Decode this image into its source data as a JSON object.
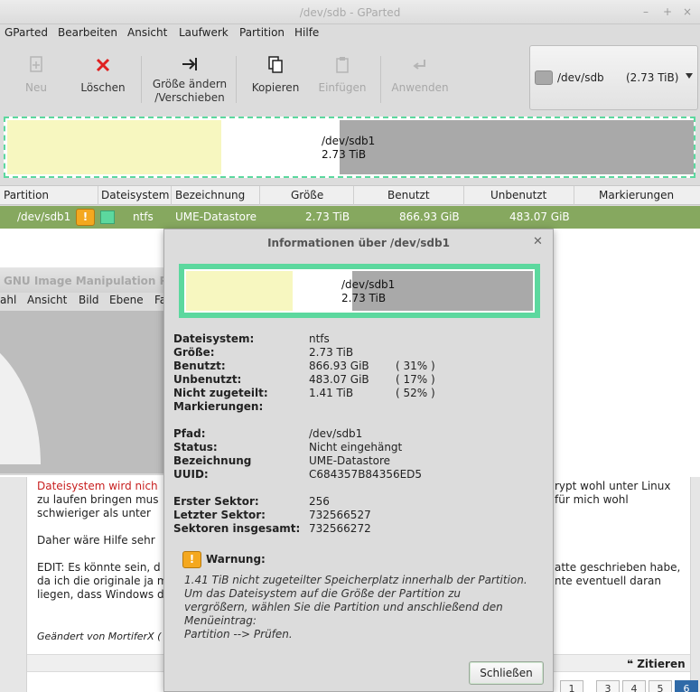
{
  "window": {
    "title": "/dev/sdb - GParted",
    "controls": [
      "–",
      "+",
      "×"
    ]
  },
  "menu": [
    "GParted",
    "Bearbeiten",
    "Ansicht",
    "Laufwerk",
    "Partition",
    "Hilfe"
  ],
  "toolbar": {
    "new": {
      "label": "Neu",
      "icon": "new-icon",
      "enabled": false
    },
    "delete": {
      "label": "Löschen",
      "icon": "delete-icon",
      "enabled": true
    },
    "resize": {
      "label_line1": "Größe ändern",
      "label_line2": "/Verschieben",
      "icon": "resize-icon",
      "enabled": true
    },
    "copy": {
      "label": "Kopieren",
      "icon": "copy-icon",
      "enabled": true
    },
    "paste": {
      "label": "Einfügen",
      "icon": "paste-icon",
      "enabled": false
    },
    "apply": {
      "label": "Anwenden",
      "icon": "apply-icon",
      "enabled": false
    }
  },
  "device_selector": {
    "device": "/dev/sdb",
    "size": "(2.73 TiB)"
  },
  "disk_map": {
    "label_line1": "/dev/sdb1",
    "label_line2": "2.73 TiB",
    "used_fraction": 0.31,
    "free_fraction": 0.17,
    "unallocated_fraction": 0.52
  },
  "partition_table": {
    "headers": [
      "Partition",
      "Dateisystem",
      "Bezeichnung",
      "Größe",
      "Benutzt",
      "Unbenutzt",
      "Markierungen"
    ],
    "rows": [
      {
        "partition": "/dev/sdb1",
        "filesystem": "ntfs",
        "label": "UME-Datastore",
        "size": "2.73 TiB",
        "used": "866.93 GiB",
        "unused": "483.07 GiB",
        "flags": "",
        "warning_icon": "!"
      }
    ]
  },
  "colors": {
    "ntfs": "#5cd89e",
    "used": "#f7f7c0",
    "unallocated": "#a9a9a9",
    "selected_row": "#86a85f",
    "warning": "#f4a81f"
  },
  "gimp": {
    "title": "GNU Image Manipulation P",
    "menu": [
      "ahl",
      "Ansicht",
      "Bild",
      "Ebene",
      "Fa"
    ]
  },
  "forum": {
    "lines": [
      "Dateisystem wird nich",
      "zu laufen bringen mus",
      "schwieriger als unter",
      "Daher wäre Hilfe sehr",
      "EDIT: Es könnte sein, d",
      "da ich die originale ja m",
      "liegen, dass Windows d"
    ],
    "right_lines": [
      "rypt wohl unter Linux",
      "für mich wohl",
      "atte geschrieben habe,",
      "nte eventuell daran"
    ],
    "signature": "Geändert von MortiferX (",
    "quote_button": "Zitieren",
    "pages": [
      "1",
      "3",
      "4",
      "5",
      "6"
    ]
  },
  "dialog": {
    "title": "Informationen über /dev/sdb1",
    "map_label_line1": "/dev/sdb1",
    "map_label_line2": "2.73 TiB",
    "fields": {
      "fs_label": "Dateisystem:",
      "fs_value": "ntfs",
      "size_label": "Größe:",
      "size_value": "2.73 TiB",
      "used_label": "Benutzt:",
      "used_value": "866.93 GiB",
      "used_pct": "( 31% )",
      "unused_label": "Unbenutzt:",
      "unused_value": "483.07 GiB",
      "unused_pct": "( 17% )",
      "unalloc_label": "Nicht zugeteilt:",
      "unalloc_value": "1.41 TiB",
      "unalloc_pct": "( 52% )",
      "flags_label": "Markierungen:",
      "path_label": "Pfad:",
      "path_value": "/dev/sdb1",
      "status_label": "Status:",
      "status_value": "Nicht eingehängt",
      "label_label": "Bezeichnung",
      "label_value": "UME-Datastore",
      "uuid_label": "UUID:",
      "uuid_value": "C684357B84356ED5",
      "first_label": "Erster Sektor:",
      "first_value": "256",
      "last_label": "Letzter Sektor:",
      "last_value": "732566527",
      "total_label": "Sektoren insgesamt:",
      "total_value": "732566272"
    },
    "warning": {
      "title": "Warnung:",
      "lines": [
        "1.41 TiB nicht zugeteilter Speicherplatz innerhalb der Partition.",
        "Um das Dateisystem auf die Größe der Partition zu",
        "vergrößern, wählen Sie die Partition und anschließend den",
        "Menüeintrag:",
        "Partition --> Prüfen."
      ]
    },
    "close_button": "Schließen"
  }
}
